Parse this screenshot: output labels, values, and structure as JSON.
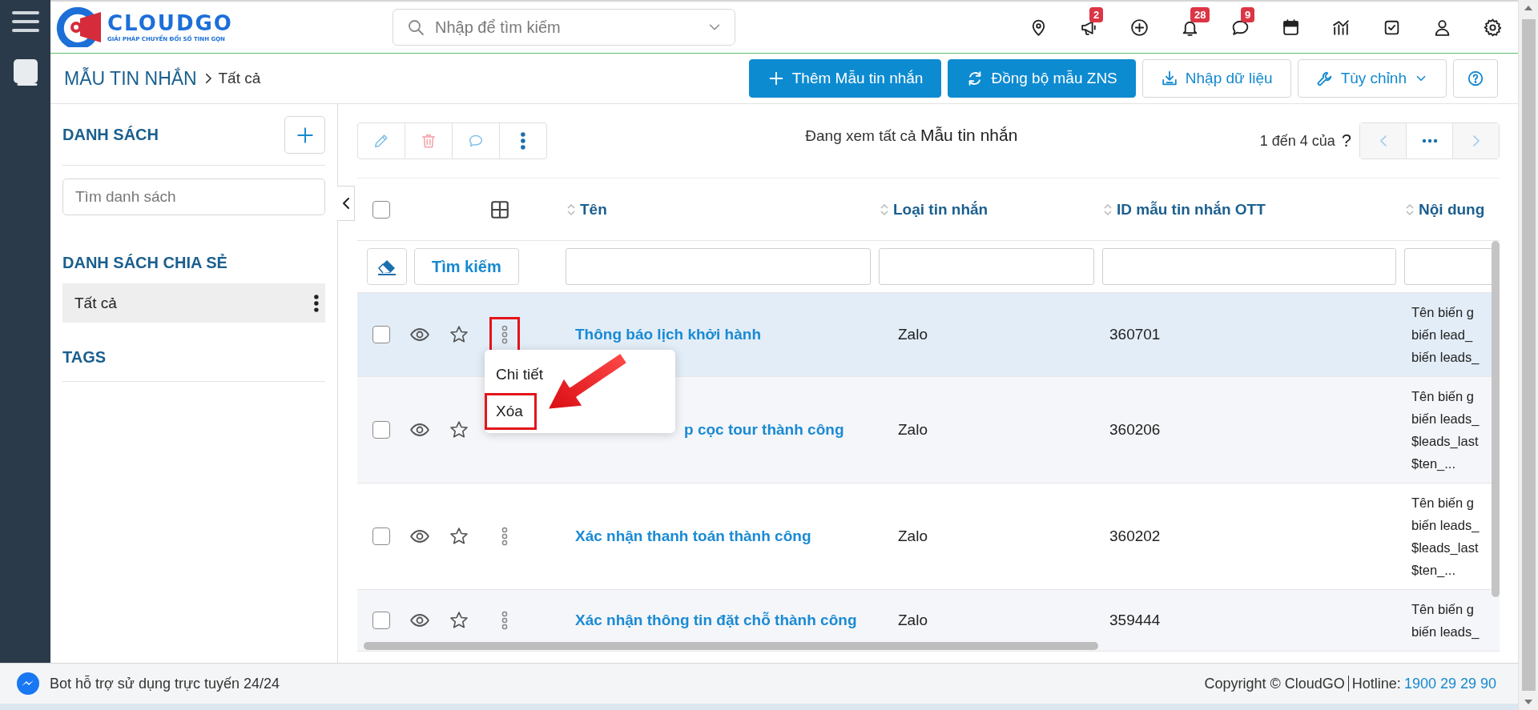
{
  "header": {
    "logo": {
      "name": "CLOUDGO",
      "tagline": "GIẢI PHÁP CHUYỂN ĐỔI SỐ TINH GỌN"
    },
    "search": {
      "placeholder": "Nhập để tìm kiếm"
    },
    "icons": [
      {
        "kind": "location"
      },
      {
        "kind": "megaphone",
        "badge": "2"
      },
      {
        "kind": "add"
      },
      {
        "kind": "bell",
        "badge": "28"
      },
      {
        "kind": "chat",
        "badge": "9"
      },
      {
        "kind": "calendar"
      },
      {
        "kind": "chart"
      },
      {
        "kind": "task"
      },
      {
        "kind": "user"
      },
      {
        "kind": "settings"
      }
    ]
  },
  "breadcrumb": {
    "module": "MẪU TIN NHẮN",
    "current": "Tất cả"
  },
  "actions": [
    {
      "kind": "add",
      "label": "Thêm Mẫu tin nhắn"
    },
    {
      "kind": "sync",
      "label": "Đồng bộ mẫu ZNS"
    },
    {
      "kind": "import",
      "label": "Nhập dữ liệu"
    },
    {
      "kind": "customize",
      "label": "Tùy chỉnh"
    },
    {
      "kind": "help"
    }
  ],
  "sidebar": {
    "title": "DANH SÁCH",
    "search_placeholder": "Tìm danh sách",
    "shared_title": "DANH SÁCH CHIA SẺ",
    "shared_items": [
      {
        "label": "Tất cả",
        "selected": true
      }
    ],
    "tags_title": "TAGS"
  },
  "toolbar": {
    "actions": [
      {
        "kind": "edit"
      },
      {
        "kind": "delete"
      },
      {
        "kind": "comment"
      },
      {
        "kind": "more"
      }
    ],
    "view_prefix": "Đang xem tất cả",
    "view_module": "Mẫu tin nhắn",
    "paging": "1 đến 4 của",
    "total": "?"
  },
  "table": {
    "select_all": false,
    "columns": [
      "Tên",
      "Loại tin nhắn",
      "ID mẫu tin nhắn OTT",
      "Nội dung"
    ],
    "search_button": "Tìm kiếm",
    "rows": [
      {
        "name": "Thông báo lịch khởi hành",
        "type": "Zalo",
        "id": "360701",
        "content": [
          "Tên biến g",
          "biến lead_",
          "biến leads_"
        ],
        "selected": true,
        "checked": false,
        "menu_open": true
      },
      {
        "name": "p cọc tour thành công",
        "type": "Zalo",
        "id": "360206",
        "content": [
          "Tên biến g",
          "biến leads_",
          "$leads_last",
          "$ten_..."
        ],
        "selected": false,
        "checked": false,
        "menu_open": false
      },
      {
        "name": "Xác nhận thanh toán thành công",
        "type": "Zalo",
        "id": "360202",
        "content": [
          "Tên biến g",
          "biến leads_",
          "$leads_last",
          "$ten_..."
        ],
        "selected": false,
        "checked": false,
        "menu_open": false
      },
      {
        "name": "Xác nhận thông tin đặt chỗ thành công",
        "type": "Zalo",
        "id": "359444",
        "content": [
          "Tên biến g",
          "biến leads_"
        ],
        "selected": false,
        "checked": false,
        "menu_open": false
      }
    ]
  },
  "context_menu": {
    "items": [
      {
        "label": "Chi tiết",
        "marked": false
      },
      {
        "label": "Xóa",
        "marked": true
      }
    ]
  },
  "footer": {
    "bot": "Bot hỗ trợ sử dụng trực tuyến 24/24",
    "copyright": "Copyright © CloudGO",
    "hotline_label": "Hotline:",
    "hotline": "1900 29 29 90"
  }
}
